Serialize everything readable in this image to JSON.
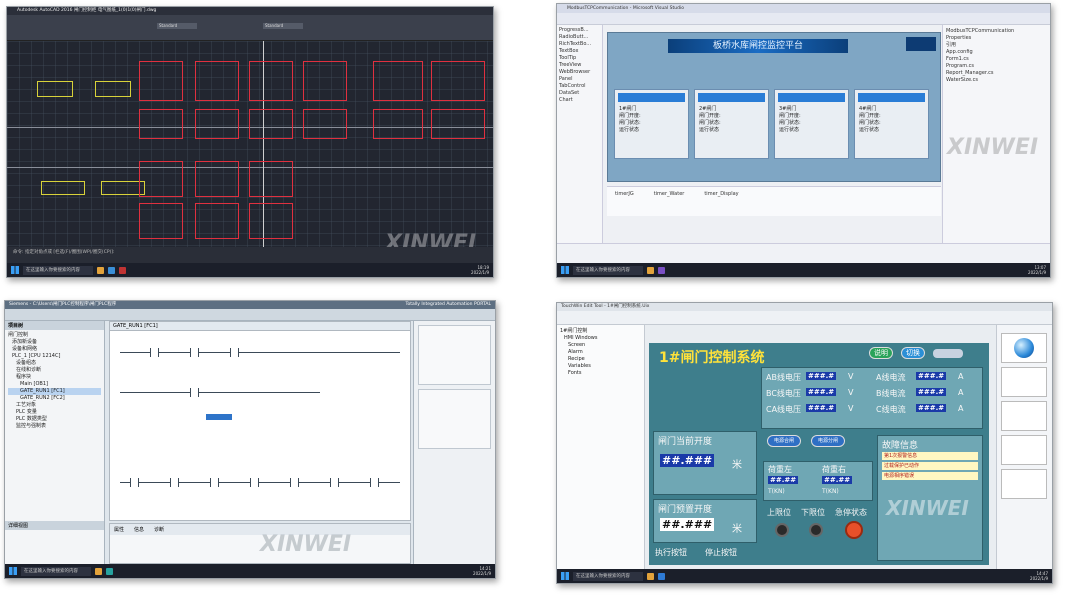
{
  "screenshots": {
    "autocad": {
      "window_title": "Autodesk AutoCAD 2016   闸门控制柜 电气图纸_1(0)1(0)闸门.dwg",
      "layer_value": "Standard",
      "command_line": "命令: 指定对角点或 [栏选(F)/圈围(WP)/圈交(CP)]:",
      "search_placeholder": "在这里输入你要搜索的内容",
      "clock_time": "18:19",
      "clock_date": "2022/1/9",
      "colors": {
        "background": "#222630",
        "border_red": "#e0303f",
        "line_yellow": "#d8d23a"
      }
    },
    "visual_studio": {
      "window_title": "ModbusTCPCommunication - Microsoft Visual Studio",
      "banner_title": "板桥水库闸控监控平台",
      "toolbox_items": [
        "ProgressB...",
        "RadioButt...",
        "RichTextBo...",
        "TextBox",
        "ToolTip",
        "TreeView",
        "WebBrowser",
        "Panel",
        "TabControl",
        "DataSet",
        "Chart"
      ],
      "gate_labels": [
        "1#闸门",
        "2#闸门",
        "3#闸门",
        "4#闸门",
        "5#闸门"
      ],
      "gate_fields": [
        "闸门开度:",
        "闸门状态:",
        "运行状态"
      ],
      "component_tray": [
        "timerJG",
        "timer_Water",
        "timer_Display"
      ],
      "solution_items": [
        "ModbusTCPCommunication",
        "Properties",
        "引用",
        "App.config",
        "Form1.cs",
        "Program.cs",
        "Report_Manager.cs",
        "WaterSize.cs"
      ],
      "search_placeholder": "在这里输入你要搜索的内容",
      "clock_time": "13:07",
      "clock_date": "2022/1/9"
    },
    "tia_portal": {
      "window_title": "Siemens - C:\\Users\\闸门PLC控制程序\\闸门PLC程序",
      "brand": "Totally Integrated Automation PORTAL",
      "tree_title": "项目树",
      "tree_items": [
        "闸门控制",
        "添加新设备",
        "设备和网络",
        "PLC_1 [CPU 1214C]",
        "设备组态",
        "在线和诊断",
        "程序块",
        "Main [OB1]",
        "GATE_RUN1 [FC1]",
        "GATE_RUN2 [FC2]",
        "工艺对象",
        "PLC 变量",
        "PLC 数据类型",
        "监控与强制表"
      ],
      "block_title": "GATE_RUN1 [FC1]",
      "detail_title": "详细视图",
      "bottom_tabs": [
        "属性",
        "信息",
        "诊断"
      ],
      "search_placeholder": "在这里输入你要搜索的内容",
      "clock_time": "14:21",
      "clock_date": "2022/1/9"
    },
    "hmi": {
      "window_title": "TouchWin Edit Tool - 1#闸门控制系统.Uix",
      "title": "1#闸门控制系统",
      "btn_explain": "说明",
      "btn_switch": "切换",
      "phase_labels": [
        "AB线电压",
        "BC线电压",
        "CA线电压",
        "A线电流",
        "B线电流",
        "C线电流"
      ],
      "num_mask": "###.#",
      "unit_v": "V",
      "unit_a": "A",
      "gate_open_label": "闸门当前开度",
      "gate_preset_label": "闸门预置开度",
      "gate_value_mask": "##.###",
      "unit_m": "米",
      "btn_motor_on": "电源合闸",
      "btn_motor_off": "电源分闸",
      "load_left": "荷重左",
      "load_right": "荷重右",
      "load_mask": "##.##",
      "load_unit": "T(KN)",
      "exec_label": "执行按钮",
      "stop_label": "停止按钮",
      "upper_limit": "上限位",
      "lower_limit": "下限位",
      "fault_state": "急停状态",
      "fault_info": "故障信息",
      "fault_rows": [
        "第1次报警信息",
        "过载保护已动作",
        "电源相序错误"
      ],
      "tree_items": [
        "1#闸门控制",
        "HMI Windows",
        "Screen",
        "Alarm",
        "Recipe",
        "Variables",
        "Fonts"
      ],
      "search_placeholder": "在这里输入你要搜索的内容",
      "clock_time": "14:47",
      "clock_date": "2022/1/9"
    }
  },
  "watermark": "XINWEI"
}
